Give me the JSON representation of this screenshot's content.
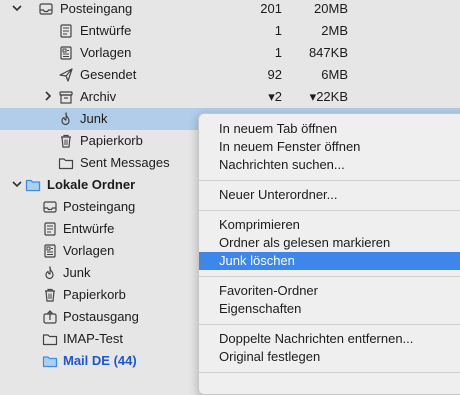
{
  "colors": {
    "selected_row": "#b2cdea",
    "menu_highlight": "#3d86ea",
    "local_folder_icon": "#3d8ee8",
    "unread_label": "#1f56d8"
  },
  "folders": {
    "posteingang": {
      "label": "Posteingang",
      "unread": "201",
      "size": "20MB",
      "icon": "inbox-icon"
    },
    "entwuerfe": {
      "label": "Entwürfe",
      "unread": "1",
      "size": "2MB",
      "icon": "drafts-icon"
    },
    "vorlagen": {
      "label": "Vorlagen",
      "unread": "1",
      "size": "847KB",
      "icon": "templates-icon"
    },
    "gesendet": {
      "label": "Gesendet",
      "unread": "92",
      "size": "6MB",
      "icon": "sent-icon"
    },
    "archiv": {
      "label": "Archiv",
      "unread": "▾2",
      "size": "▾22KB",
      "icon": "archive-icon"
    },
    "junk": {
      "label": "Junk",
      "icon": "junk-icon"
    },
    "papierkorb": {
      "label": "Papierkorb",
      "icon": "trash-icon"
    },
    "sent_messages": {
      "label": "Sent Messages",
      "icon": "folder-icon"
    }
  },
  "local": {
    "header": {
      "label": "Lokale Ordner",
      "icon": "local-folders-icon"
    },
    "items": [
      {
        "label": "Posteingang",
        "icon": "inbox-icon"
      },
      {
        "label": "Entwürfe",
        "icon": "drafts-icon"
      },
      {
        "label": "Vorlagen",
        "icon": "templates-icon"
      },
      {
        "label": "Junk",
        "icon": "junk-icon"
      },
      {
        "label": "Papierkorb",
        "icon": "trash-icon"
      },
      {
        "label": "Postausgang",
        "icon": "outbox-icon"
      },
      {
        "label": "IMAP-Test",
        "icon": "folder-icon"
      },
      {
        "label": "Mail DE (44)",
        "icon": "folder-icon"
      }
    ]
  },
  "menu": {
    "open_tab": "In neuem Tab öffnen",
    "open_window": "In neuem Fenster öffnen",
    "search": "Nachrichten suchen...",
    "new_subfolder": "Neuer Unterordner...",
    "compact": "Komprimieren",
    "mark_read": "Ordner als gelesen markieren",
    "delete_junk": "Junk löschen",
    "favorite": "Favoriten-Ordner",
    "properties": "Eigenschaften",
    "remove_duplicates": "Doppelte Nachrichten entfernen...",
    "set_original": "Original festlegen"
  }
}
